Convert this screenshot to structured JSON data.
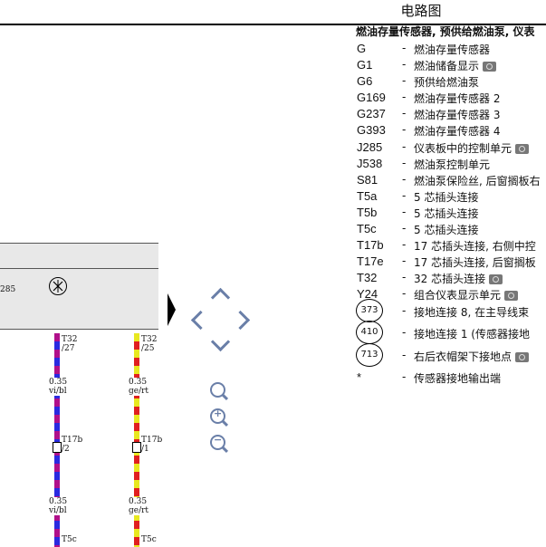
{
  "window": {
    "title": "电路图"
  },
  "diagram": {
    "component_label": "285",
    "wire_left": {
      "pin_top": "T32",
      "pin_top_num": "/27",
      "size": "0.35",
      "color": "vi/bl",
      "conn": "T17b",
      "conn_num": "/2",
      "size2": "0.35",
      "color2": "vi/bl",
      "pin_bottom": "T5c"
    },
    "wire_right": {
      "pin_top": "T32",
      "pin_top_num": "/25",
      "size": "0.35",
      "color": "ge/rt",
      "conn": "T17b",
      "conn_num": "/1",
      "size2": "0.35",
      "color2": "ge/rt",
      "pin_bottom": "T5c"
    }
  },
  "nav": {
    "pan_up": "pan-up",
    "pan_left": "pan-left",
    "pan_right": "pan-right",
    "pan_down": "pan-down",
    "zoom": "zoom",
    "zoom_in": "zoom-in",
    "zoom_out": "zoom-out"
  },
  "legend": {
    "heading": "燃油存量传感器, 预供给燃油泵, 仪表",
    "items": [
      {
        "code": "G",
        "desc": "燃油存量传感器",
        "camera": false
      },
      {
        "code": "G1",
        "desc": "燃油储备显示",
        "camera": true
      },
      {
        "code": "G6",
        "desc": "预供给燃油泵",
        "camera": false
      },
      {
        "code": "G169",
        "desc": "燃油存量传感器 2",
        "camera": false
      },
      {
        "code": "G237",
        "desc": "燃油存量传感器 3",
        "camera": false
      },
      {
        "code": "G393",
        "desc": "燃油存量传感器 4",
        "camera": false
      },
      {
        "code": "J285",
        "desc": "仪表板中的控制单元",
        "camera": true
      },
      {
        "code": "J538",
        "desc": "燃油泵控制单元",
        "camera": false
      },
      {
        "code": "S81",
        "desc": "燃油泵保险丝, 后窗搁板右",
        "camera": false
      },
      {
        "code": "T5a",
        "desc": "5 芯插头连接",
        "camera": false
      },
      {
        "code": "T5b",
        "desc": "5 芯插头连接",
        "camera": false
      },
      {
        "code": "T5c",
        "desc": "5 芯插头连接",
        "camera": false
      },
      {
        "code": "T17b",
        "desc": "17 芯插头连接, 右侧中控",
        "camera": false
      },
      {
        "code": "T17e",
        "desc": "17 芯插头连接, 后窗搁板",
        "camera": false
      },
      {
        "code": "T32",
        "desc": "32 芯插头连接",
        "camera": true
      },
      {
        "code": "Y24",
        "desc": "组合仪表显示单元",
        "camera": true
      }
    ],
    "grounds": [
      {
        "code": "373",
        "desc": "接地连接 8, 在主导线束",
        "camera": false
      },
      {
        "code": "410",
        "desc": "接地连接 1 (传感器接地",
        "camera": false
      },
      {
        "code": "713",
        "desc": "右后衣帽架下接地点",
        "camera": true
      }
    ],
    "footnote": {
      "code": "*",
      "desc": "传感器接地输出端"
    }
  },
  "colors": {
    "accent": "#6a7fa8",
    "wire_vi": "#b0108a",
    "wire_bl": "#2a2ae0",
    "wire_ge": "#e8e820",
    "wire_rt": "#e02020"
  }
}
